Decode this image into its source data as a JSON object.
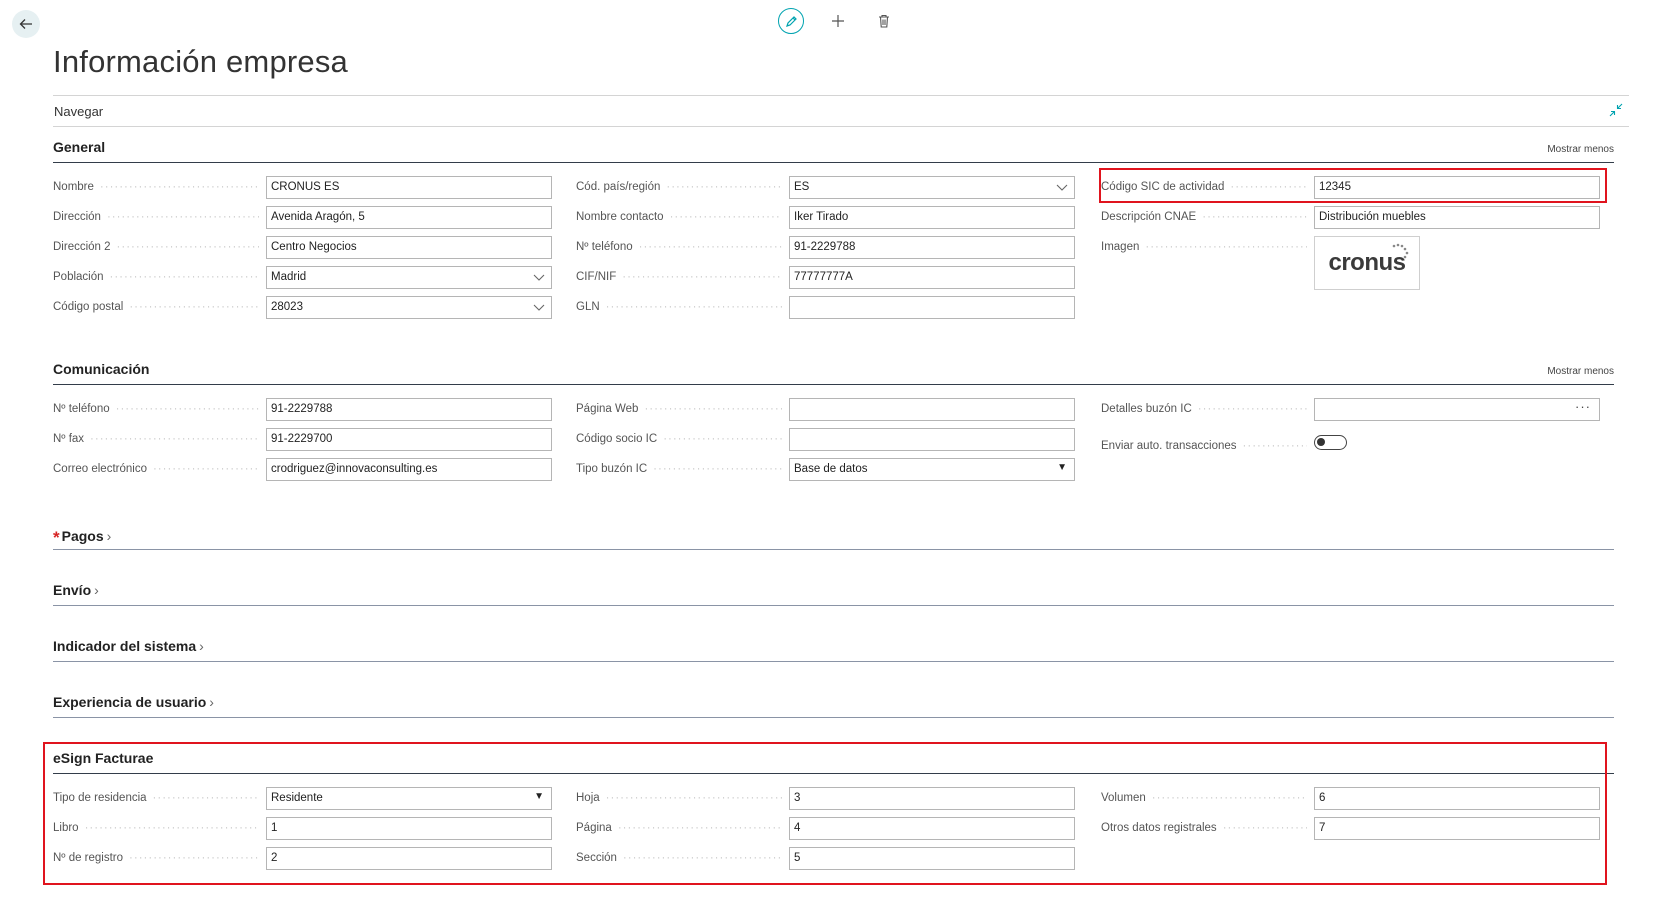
{
  "page": {
    "title": "Información empresa",
    "nav_label": "Navegar"
  },
  "sections": {
    "general": {
      "title": "General",
      "show_less": "Mostrar menos"
    },
    "comunicacion": {
      "title": "Comunicación",
      "show_less": "Mostrar menos"
    },
    "pagos": {
      "title": "Pagos",
      "required": "*"
    },
    "envio": {
      "title": "Envío"
    },
    "indicador": {
      "title": "Indicador del sistema"
    },
    "experiencia": {
      "title": "Experiencia de usuario"
    },
    "esign": {
      "title": "eSign Facturae"
    }
  },
  "general": {
    "nombre": {
      "label": "Nombre",
      "value": "CRONUS ES"
    },
    "direccion": {
      "label": "Dirección",
      "value": "Avenida Aragón, 5"
    },
    "direccion2": {
      "label": "Dirección 2",
      "value": "Centro Negocios"
    },
    "poblacion": {
      "label": "Población",
      "value": "Madrid"
    },
    "codigo_postal": {
      "label": "Código postal",
      "value": "28023"
    },
    "pais": {
      "label": "Cód. país/región",
      "value": "ES"
    },
    "contacto": {
      "label": "Nombre contacto",
      "value": "Iker Tirado"
    },
    "telefono": {
      "label": "Nº teléfono",
      "value": "91-2229788"
    },
    "cif": {
      "label": "CIF/NIF",
      "value": "77777777A"
    },
    "gln": {
      "label": "GLN",
      "value": ""
    },
    "sic": {
      "label": "Código SIC de actividad",
      "value": "12345"
    },
    "cnae": {
      "label": "Descripción CNAE",
      "value": "Distribución muebles"
    },
    "imagen": {
      "label": "Imagen",
      "logo_text": "cronus"
    }
  },
  "comunicacion": {
    "telefono": {
      "label": "Nº teléfono",
      "value": "91-2229788"
    },
    "fax": {
      "label": "Nº fax",
      "value": "91-2229700"
    },
    "email": {
      "label": "Correo electrónico",
      "value": "crodriguez@innovaconsulting.es"
    },
    "web": {
      "label": "Página Web",
      "value": ""
    },
    "socio_ic": {
      "label": "Código socio IC",
      "value": ""
    },
    "tipo_buzon": {
      "label": "Tipo buzón IC",
      "value": "Base de datos"
    },
    "detalles_buzon": {
      "label": "Detalles buzón IC",
      "value": "",
      "more": "···"
    },
    "enviar_auto": {
      "label": "Enviar auto. transacciones",
      "enabled": false
    }
  },
  "esign": {
    "tipo_residencia": {
      "label": "Tipo de residencia",
      "value": "Residente"
    },
    "libro": {
      "label": "Libro",
      "value": "1"
    },
    "registro": {
      "label": "Nº de registro",
      "value": "2"
    },
    "hoja": {
      "label": "Hoja",
      "value": "3"
    },
    "pagina": {
      "label": "Página",
      "value": "4"
    },
    "seccion": {
      "label": "Sección",
      "value": "5"
    },
    "volumen": {
      "label": "Volumen",
      "value": "6"
    },
    "otros": {
      "label": "Otros datos registrales",
      "value": "7"
    }
  },
  "colors": {
    "accent": "#00a3b0",
    "highlight": "#e0141e"
  }
}
